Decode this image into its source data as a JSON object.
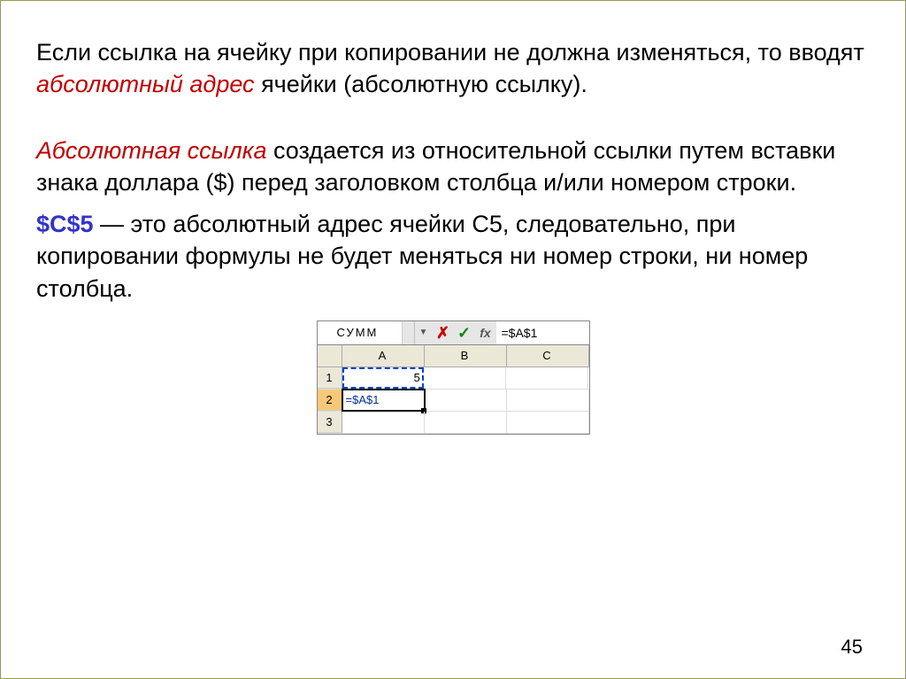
{
  "para1": {
    "t1": "Если ссылка на ячейку при копировании не должна изменяться, то вводят ",
    "em": "абсолютный адрес",
    "t2": " ячейки (абсолютную ссылку)."
  },
  "para2": {
    "em": "Абсолютная ссылка",
    "t1": " создается из относительной ссылки путем вставки знака доллара ($) перед заголовком столбца и/или номером строки."
  },
  "para3": {
    "strong": "$C$5",
    "t1": " — это абсолютный адрес ячейки С5, следовательно, при копировании формулы не будет меняться ни номер строки, ни номер столбца."
  },
  "excel": {
    "name_box": "СУММ",
    "cancel": "✗",
    "confirm": "✓",
    "fx": "fx",
    "formula": "=$A$1",
    "columns": [
      "A",
      "B",
      "C"
    ],
    "rows": [
      "1",
      "2",
      "3"
    ],
    "cell_a1": "5",
    "cell_a2": "=$A$1"
  },
  "page_number": "45"
}
